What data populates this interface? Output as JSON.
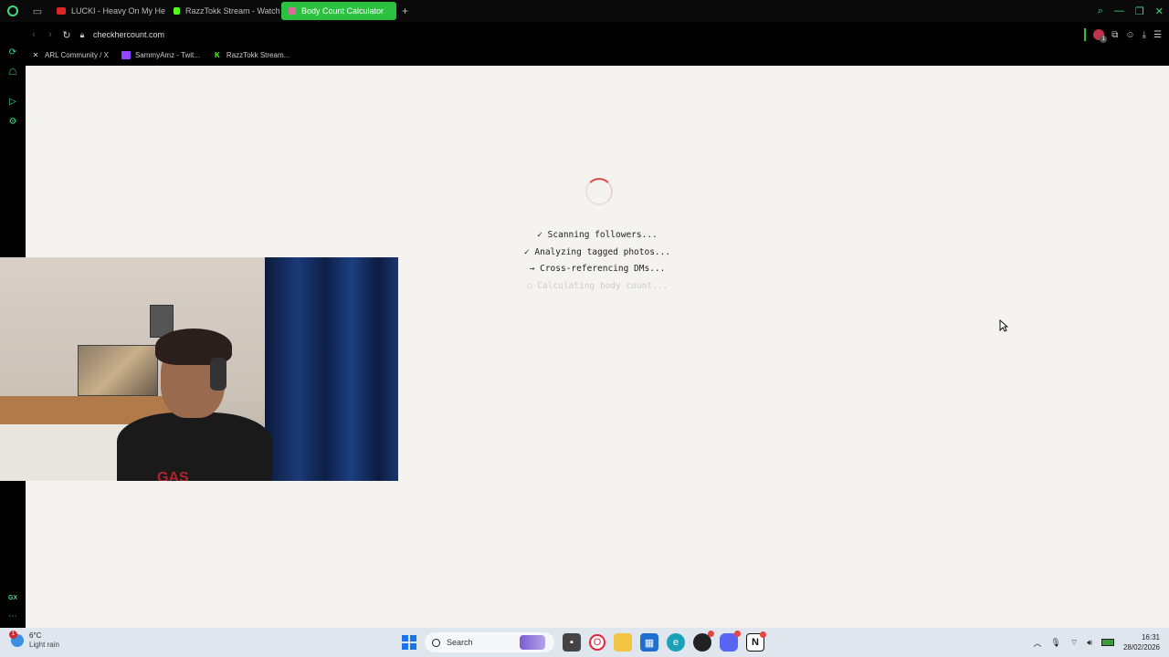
{
  "browser": {
    "tabs": [
      {
        "label": "LUCKI - Heavy On My He",
        "favicon_color": "#e02323",
        "active": false
      },
      {
        "label": "RazzTokk Stream - Watch",
        "favicon_color": "#53fc18",
        "active": false
      },
      {
        "label": "Body Count Calculator",
        "favicon_color": "#e06a9e",
        "active": true
      }
    ],
    "new_tab_symbol": "+",
    "url": "checkhercount.com",
    "bookmarks": [
      {
        "label": "ARL Community / X",
        "icon": "x-icon"
      },
      {
        "label": "SammyAmz - Twit...",
        "icon": "twitch-icon"
      },
      {
        "label": "RazzTokk Stream...",
        "icon": "kick-icon"
      }
    ],
    "extension_badge": "1",
    "accent_color": "#29c13f"
  },
  "page": {
    "steps": [
      {
        "mark": "✓",
        "text": "Scanning followers...",
        "state": "done"
      },
      {
        "mark": "✓",
        "text": "Analyzing tagged photos...",
        "state": "done"
      },
      {
        "mark": "→",
        "text": "Cross-referencing DMs...",
        "state": "active"
      },
      {
        "mark": "○",
        "text": "Calculating body count...",
        "state": "pending"
      }
    ],
    "spinner_color": "#e14b4b"
  },
  "webcam": {
    "shirt_text": "GAS"
  },
  "taskbar": {
    "weather": {
      "temp": "6°C",
      "condition": "Light rain",
      "badge": "1"
    },
    "search_placeholder": "Search",
    "time": "16:31",
    "date": "28/02/2026"
  }
}
